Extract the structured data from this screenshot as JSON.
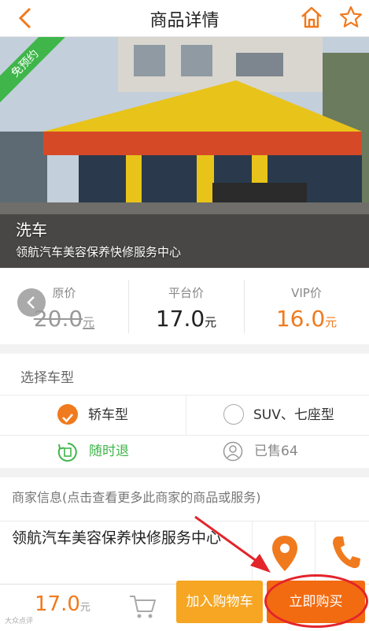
{
  "header": {
    "title": "商品详情"
  },
  "hero": {
    "badge": "免预约",
    "service_name": "洗车",
    "shop_subtitle": "领航汽车美容保养快修服务中心"
  },
  "prices": {
    "original": {
      "label": "原价",
      "value": "20.0",
      "unit": "元"
    },
    "platform": {
      "label": "平台价",
      "value": "17.0",
      "unit": "元"
    },
    "vip": {
      "label": "VIP价",
      "value": "16.0",
      "unit": "元"
    }
  },
  "model": {
    "heading": "选择车型",
    "options": [
      {
        "label": "轿车型",
        "selected": true
      },
      {
        "label": "SUV、七座型",
        "selected": false
      }
    ],
    "refund_text": "随时退",
    "sold_text": "已售64"
  },
  "merchant": {
    "heading": "商家信息(点击查看更多此商家的商品或服务)",
    "name": "领航汽车美容保养快修服务中心"
  },
  "footer": {
    "price": "17.0",
    "unit": "元",
    "add_to_cart": "加入购物车",
    "buy_now": "立即购买",
    "watermark": "大众点评"
  },
  "colors": {
    "accent": "#f07a1e",
    "green": "#3fb54a",
    "buy": "#f26b11",
    "addcart": "#f6a623",
    "annotation": "#e3242b"
  }
}
